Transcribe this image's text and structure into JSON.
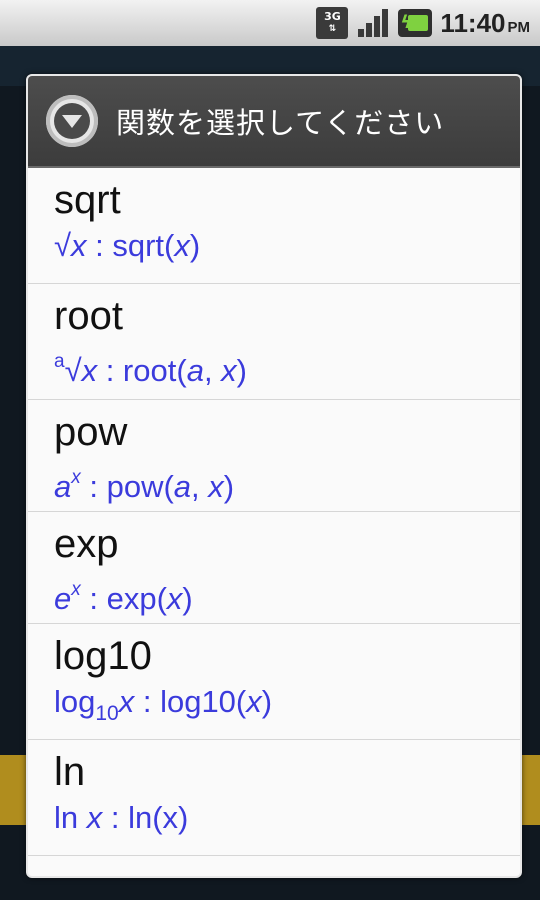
{
  "status_bar": {
    "network": "3G",
    "time": "11:40",
    "ampm": "PM"
  },
  "dialog": {
    "title": "関数を選択してください",
    "items": [
      {
        "name": "sqrt",
        "formula_parts": [
          "√",
          "x",
          " : sqrt(",
          "x",
          ")"
        ]
      },
      {
        "name": "root",
        "formula_parts": [
          "a",
          "√",
          "x",
          " : root(",
          "a",
          ", ",
          "x",
          ")"
        ]
      },
      {
        "name": "pow",
        "formula_parts": [
          "a",
          "x",
          " : pow(",
          "a",
          ", ",
          "x",
          ")"
        ]
      },
      {
        "name": "exp",
        "formula_parts": [
          "e",
          "x",
          " : exp(",
          "x",
          ")"
        ]
      },
      {
        "name": "log10",
        "formula_parts": [
          "log",
          "10",
          "x",
          " : log10(",
          "x",
          ")"
        ]
      },
      {
        "name": "ln",
        "formula_parts": [
          "ln ",
          "x",
          " : ln(x)"
        ]
      }
    ]
  },
  "colors": {
    "formula": "#3b3bdc",
    "header_bg": "#444444",
    "battery": "#7fd140"
  }
}
